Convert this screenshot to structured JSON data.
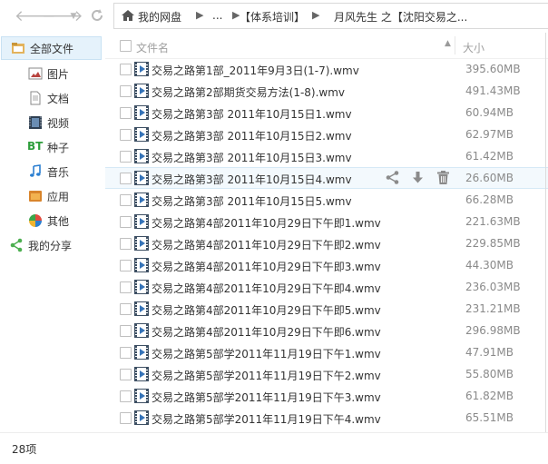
{
  "nav": {
    "home_label": "我的网盘",
    "ellipsis": "...",
    "crumbs": [
      "【体系培训】",
      "月风先生 之【沈阳交易之..."
    ]
  },
  "sidebar": {
    "items": [
      {
        "label": "全部文件",
        "icon": "all-files-icon"
      },
      {
        "label": "图片",
        "icon": "image-icon"
      },
      {
        "label": "文档",
        "icon": "document-icon"
      },
      {
        "label": "视频",
        "icon": "video-icon"
      },
      {
        "label": "种子",
        "icon": "bt-icon"
      },
      {
        "label": "音乐",
        "icon": "music-icon"
      },
      {
        "label": "应用",
        "icon": "app-icon"
      },
      {
        "label": "其他",
        "icon": "other-icon"
      },
      {
        "label": "我的分享",
        "icon": "share-icon"
      }
    ]
  },
  "list": {
    "header_name": "文件名",
    "header_size": "大小",
    "files": [
      {
        "name": "交易之路第1部_2011年9月3日(1-7).wmv",
        "size": "395.60MB"
      },
      {
        "name": "交易之路第2部期货交易方法(1-8).wmv",
        "size": "491.43MB"
      },
      {
        "name": "交易之路第3部 2011年10月15日1.wmv",
        "size": "60.94MB"
      },
      {
        "name": "交易之路第3部 2011年10月15日2.wmv",
        "size": "62.97MB"
      },
      {
        "name": "交易之路第3部 2011年10月15日3.wmv",
        "size": "61.42MB"
      },
      {
        "name": "交易之路第3部 2011年10月15日4.wmv",
        "size": "26.60MB"
      },
      {
        "name": "交易之路第3部 2011年10月15日5.wmv",
        "size": "66.28MB"
      },
      {
        "name": "交易之路第4部2011年10月29日下午即1.wmv",
        "size": "221.63MB"
      },
      {
        "name": "交易之路第4部2011年10月29日下午即2.wmv",
        "size": "229.85MB"
      },
      {
        "name": "交易之路第4部2011年10月29日下午即3.wmv",
        "size": "44.30MB"
      },
      {
        "name": "交易之路第4部2011年10月29日下午即4.wmv",
        "size": "236.03MB"
      },
      {
        "name": "交易之路第4部2011年10月29日下午即5.wmv",
        "size": "231.21MB"
      },
      {
        "name": "交易之路第4部2011年10月29日下午即6.wmv",
        "size": "296.98MB"
      },
      {
        "name": "交易之路第5部学2011年11月19日下午1.wmv",
        "size": "47.91MB"
      },
      {
        "name": "交易之路第5部学2011年11月19日下午2.wmv",
        "size": "55.80MB"
      },
      {
        "name": "交易之路第5部学2011年11月19日下午3.wmv",
        "size": "61.82MB"
      },
      {
        "name": "交易之路第5部学2011年11月19日下午4.wmv",
        "size": "65.51MB"
      }
    ]
  },
  "status": {
    "count": "28项"
  },
  "colors": {
    "accent": "#3573b8",
    "active_bg": "#e5f2fb",
    "icon_gray": "#b9b9b9"
  }
}
